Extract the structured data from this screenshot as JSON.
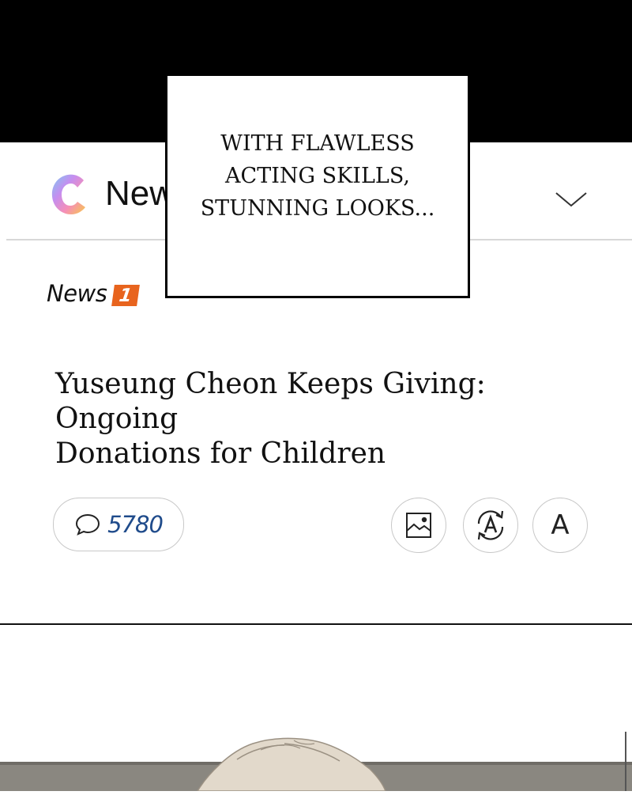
{
  "app": {
    "title": "News",
    "logo_letter": "C",
    "icons": {
      "logo": "c-gradient-logo-icon",
      "menu": "chevron-down-icon"
    }
  },
  "caption": {
    "lines": [
      "WITH FLAWLESS",
      "ACTING SKILLS,",
      "STUNNING LOOKS..."
    ]
  },
  "article": {
    "source_name": "News",
    "source_badge": "1",
    "headline_line1": "Yuseung Cheon Keeps Giving: Ongoing",
    "headline_line2": "Donations for Children",
    "comment_count": "5780",
    "font_button_label": "A",
    "icons": {
      "comment": "speech-bubble-icon",
      "image": "image-icon",
      "translate": "translate-icon",
      "font": "font-size-icon"
    }
  },
  "colors": {
    "badge": "#e8641e",
    "comment_count": "#1f4b8b",
    "background_top": "#000000"
  }
}
